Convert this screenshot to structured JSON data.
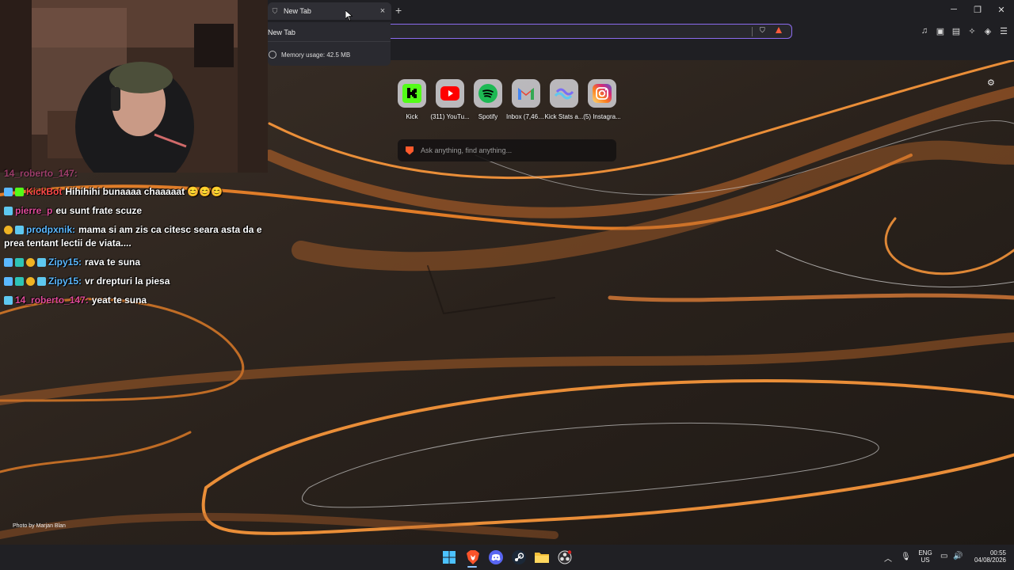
{
  "browser": {
    "tab_title": "New Tab",
    "tab_close": "×",
    "new_tab_button": "+",
    "hover_card": {
      "title": "New Tab",
      "memory": "Memory usage: 42.5 MB"
    },
    "window_controls": {
      "minimize": "─",
      "restore": "❐",
      "close": "✕"
    },
    "accent_color": "#8c6cf0"
  },
  "shortcuts": [
    {
      "label": "Kick",
      "icon": "kick-icon",
      "color": "#53fc18"
    },
    {
      "label": "(311) YouTu...",
      "icon": "youtube-icon",
      "color": "#ff0000"
    },
    {
      "label": "Spotify",
      "icon": "spotify-icon",
      "color": "#1db954"
    },
    {
      "label": "Inbox (7,469)...",
      "icon": "gmail-icon",
      "color": "#ea4335"
    },
    {
      "label": "Kick Stats a...",
      "icon": "kickstats-icon",
      "color": "#7a6cf5"
    },
    {
      "label": "(5) Instagra...",
      "icon": "instagram-icon",
      "color": "#d62976"
    }
  ],
  "search": {
    "placeholder": "Ask anything, find anything..."
  },
  "photo_credit": "Photo by Marjan Blan",
  "chat": {
    "messages": [
      {
        "user": "KickBot",
        "user_color": "#ff4a4a",
        "text": "Hihihihi bunaaaa chaaaaat 😊😊😊"
      },
      {
        "user": "pierre_p",
        "user_color": "#e04b9a",
        "text": "eu sunt frate scuze"
      },
      {
        "user": "prodpxnik:",
        "user_color": "#5bb8ff",
        "text": "mama si am zis ca citesc seara asta da e",
        "text2": "prea tentant lectii de viata...."
      },
      {
        "user": "Zipy15:",
        "user_color": "#5bb8ff",
        "text": "rava te suna"
      },
      {
        "user": "Zipy15:",
        "user_color": "#5bb8ff",
        "text": "vr drepturi la piesa"
      },
      {
        "user": "14_roberto_147:",
        "user_color": "#e04b9a",
        "text": "yeat te suna"
      }
    ],
    "partial_top": "14_roberto_147:"
  },
  "taskbar": {
    "apps": [
      "windows-start-icon",
      "brave-icon",
      "discord-icon",
      "steam-icon",
      "file-explorer-icon",
      "obs-icon"
    ],
    "language": "ENG",
    "region": "US",
    "time": "00:55",
    "date": "04/08/2026"
  }
}
